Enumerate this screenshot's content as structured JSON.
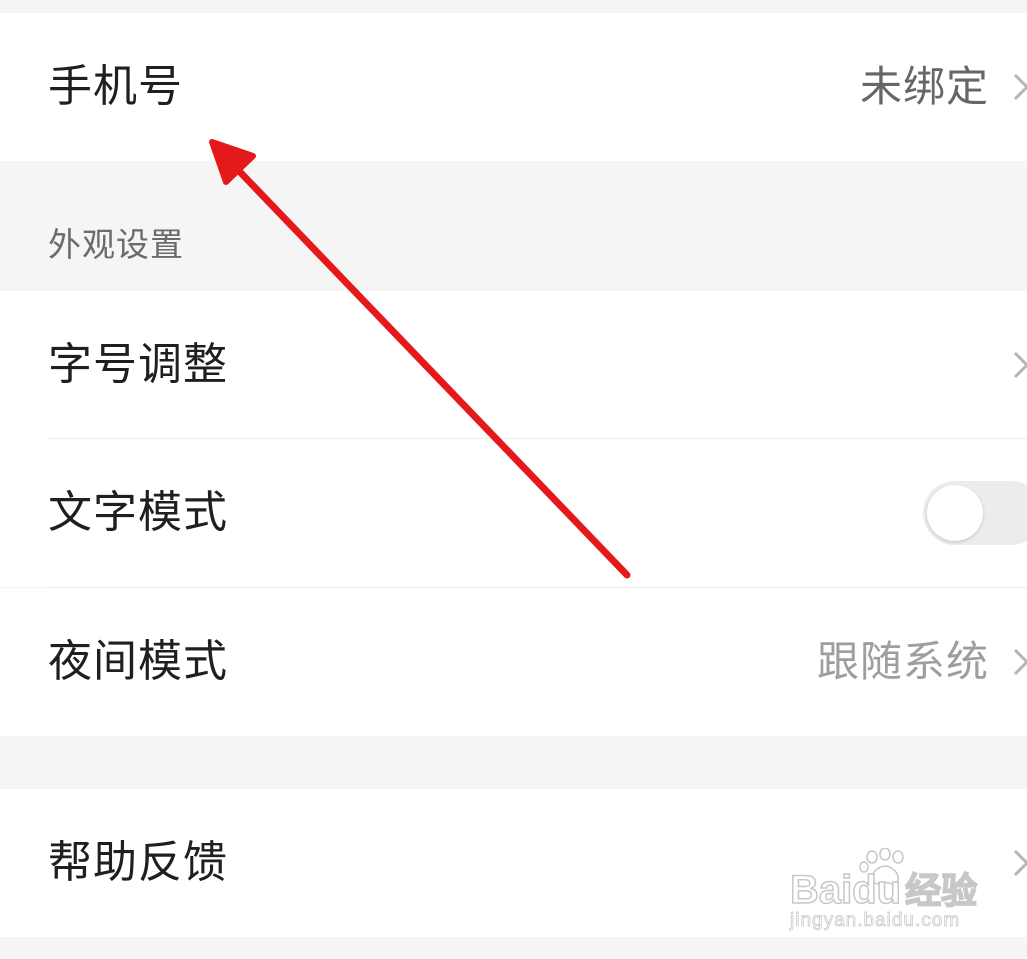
{
  "account": {
    "phone_row": {
      "label": "手机号",
      "value": "未绑定",
      "value_color": "#666666"
    }
  },
  "appearance": {
    "section_title": "外观设置",
    "font_size_row": {
      "label": "字号调整"
    },
    "text_mode_row": {
      "label": "文字模式",
      "enabled": false
    },
    "night_mode_row": {
      "label": "夜间模式",
      "value": "跟随系统",
      "value_color": "#9e9e9e"
    }
  },
  "support": {
    "help_row": {
      "label": "帮助反馈"
    }
  },
  "annotation": {
    "arrow_color": "#e5191c",
    "icon": "red-arrow-icon"
  },
  "watermark": {
    "brand": "Bai",
    "brand_suffix": "du",
    "brand_cn": "经验",
    "url": "jingyan.baidu.com"
  },
  "colors": {
    "background": "#f5f5f5",
    "card": "#ffffff",
    "text_primary": "#1f1f1f",
    "divider": "#ececec",
    "chevron": "#b5b5b5"
  }
}
